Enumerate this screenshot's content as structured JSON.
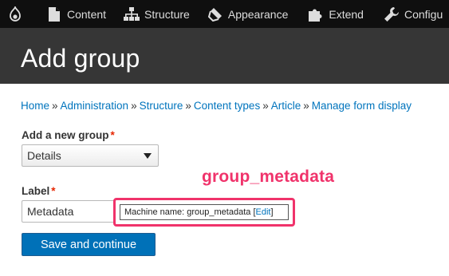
{
  "toolbar": {
    "items": [
      {
        "label": "Content",
        "icon": "file-icon"
      },
      {
        "label": "Structure",
        "icon": "sitemap-icon"
      },
      {
        "label": "Appearance",
        "icon": "paintbrush-icon"
      },
      {
        "label": "Extend",
        "icon": "puzzle-icon"
      },
      {
        "label": "Configu",
        "icon": "wrench-icon"
      }
    ]
  },
  "page": {
    "title": "Add group"
  },
  "breadcrumb": {
    "items": [
      "Home",
      "Administration",
      "Structure",
      "Content types",
      "Article",
      "Manage form display"
    ],
    "separator": "»"
  },
  "form": {
    "group_label": "Add a new group",
    "required_mark": "*",
    "group_select_value": "Details",
    "label_label": "Label",
    "label_value": "Metadata",
    "machine_name_prefix": "Machine name: group_metadata",
    "machine_name_edit": "Edit",
    "submit_label": "Save and continue"
  },
  "annotation": {
    "text": "group_metadata",
    "color": "#f0336b"
  },
  "colors": {
    "toolbar_bg": "#0f0f0f",
    "header_bg": "#363636",
    "link": "#0074bd",
    "primary_button": "#0071b8",
    "required": "#e62600"
  }
}
